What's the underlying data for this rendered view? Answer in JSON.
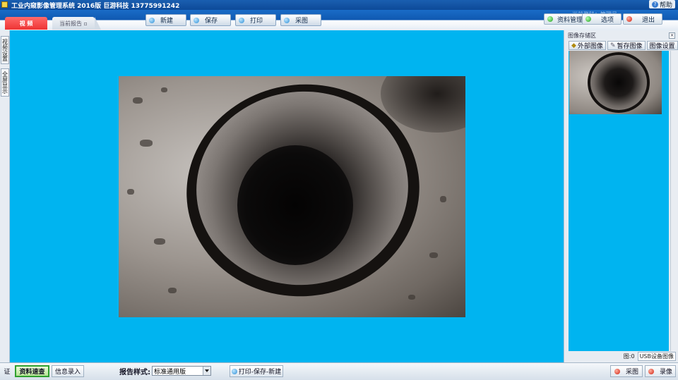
{
  "title_bar": {
    "title": "工业内窥影像管理系统 2016版   巨游科技  13775991242",
    "help_label": "帮助"
  },
  "tabs": {
    "video": "视 频",
    "report": "当前报告 ▫"
  },
  "toolbar": {
    "new_label": "新建",
    "save_label": "保存",
    "print_label": "打印",
    "capture_label": "采图"
  },
  "user": {
    "label": "当前登陆：管理员"
  },
  "right_toolbar": {
    "data_management": "资料管理",
    "options": "选项",
    "exit": "退出"
  },
  "left_tabs": {
    "video_settings": "视频设置",
    "fullscreen": "全屏显示"
  },
  "image_panel": {
    "title": "图像存储区",
    "tabs": [
      "外部图像",
      "暂存图像",
      "图像设置"
    ],
    "count_label": "图:0",
    "usb_label": "USB设备图像"
  },
  "bottom": {
    "cert_label": "证",
    "quick_search": "资料速查",
    "info_entry": "信息录入",
    "report_style_label": "报告样式:",
    "report_style_value": "标准通用版",
    "print_save_new": "打印-保存-新建",
    "capture": "采图",
    "record": "录像"
  },
  "colors": {
    "video_area": "#00b4f0",
    "title_bar": "#0d4a99"
  }
}
